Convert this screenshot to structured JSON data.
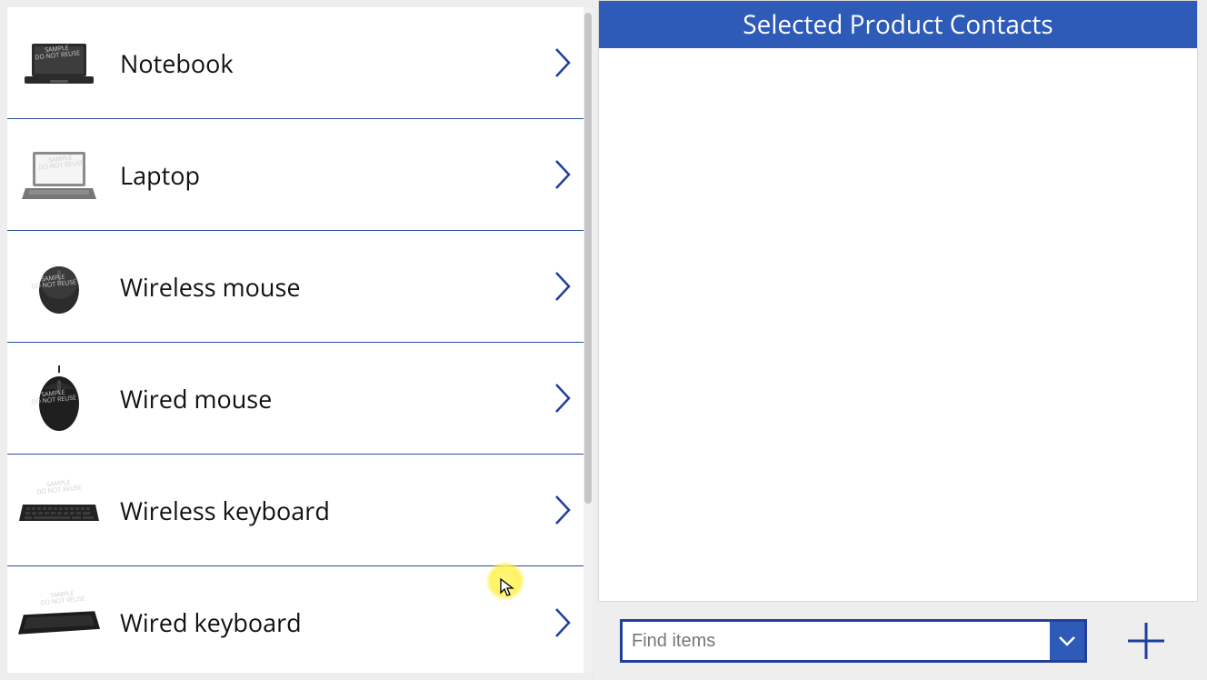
{
  "colors": {
    "accent": "#2e5bb8",
    "divider": "#2e4b9a"
  },
  "left": {
    "products": [
      {
        "name": "Notebook",
        "icon": "notebook"
      },
      {
        "name": "Laptop",
        "icon": "laptop"
      },
      {
        "name": "Wireless mouse",
        "icon": "wireless-mouse"
      },
      {
        "name": "Wired mouse",
        "icon": "wired-mouse"
      },
      {
        "name": "Wireless keyboard",
        "icon": "wireless-keyboard"
      },
      {
        "name": "Wired keyboard",
        "icon": "wired-keyboard"
      }
    ]
  },
  "right": {
    "header": "Selected Product Contacts",
    "find_placeholder": "Find items"
  }
}
